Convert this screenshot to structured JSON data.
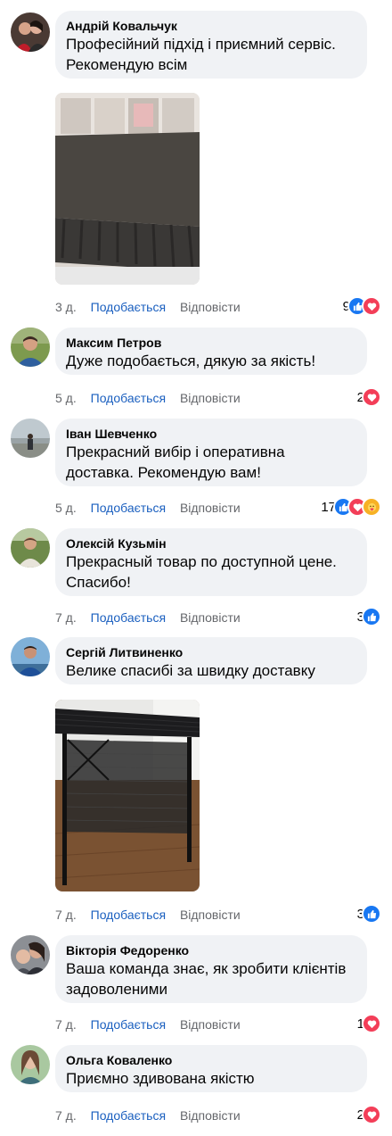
{
  "comments": [
    {
      "author": "Андрій Ковальчук",
      "text": "Професійний підхід і приємний сервіс. Рекомендую всім",
      "time": "3 д.",
      "like_label": "Подобається",
      "reply_label": "Відповісти",
      "reaction_count": "9",
      "reactions": [
        "like-icon",
        "love-icon"
      ]
    },
    {
      "author": "Максим Петров",
      "text": "Дуже подобається, дякую за якість!",
      "time": "5 д.",
      "like_label": "Подобається",
      "reply_label": "Відповісти",
      "reaction_count": "2",
      "reactions": [
        "love-icon"
      ]
    },
    {
      "author": "Іван Шевченко",
      "text": "Прекрасний вибір і оперативна доставка. Рекомендую вам!",
      "time": "5 д.",
      "like_label": "Подобається",
      "reply_label": "Відповісти",
      "reaction_count": "17",
      "reactions": [
        "like-icon",
        "love-icon",
        "care-icon"
      ]
    },
    {
      "author": "Олексій Кузьмін",
      "text": "Прекрасный товар по доступной цене. Спасибо!",
      "time": "7 д.",
      "like_label": "Подобається",
      "reply_label": "Відповісти",
      "reaction_count": "3",
      "reactions": [
        "like-icon"
      ]
    },
    {
      "author": "Сергій Литвиненко",
      "text": "Велике спасибі за швидку доставку",
      "time": "7 д.",
      "like_label": "Подобається",
      "reply_label": "Відповісти",
      "reaction_count": "3",
      "reactions": [
        "like-icon"
      ]
    },
    {
      "author": "Вікторія Федоренко",
      "text": "Ваша команда знає, як зробити клієнтів задоволеними",
      "time": "7 д.",
      "like_label": "Подобається",
      "reply_label": "Відповісти",
      "reaction_count": "1",
      "reactions": [
        "love-icon"
      ]
    },
    {
      "author": "Ольга Коваленко",
      "text": "Приємно здивована якістю",
      "time": "7 д.",
      "like_label": "Подобається",
      "reply_label": "Відповісти",
      "reaction_count": "2",
      "reactions": [
        "love-icon"
      ]
    }
  ],
  "colors": {
    "bubble": "#f0f2f5",
    "like_link": "#1a5fbf",
    "meta": "#65676b",
    "like_reaction": "#1877f2",
    "love_reaction": "#f33e58"
  }
}
